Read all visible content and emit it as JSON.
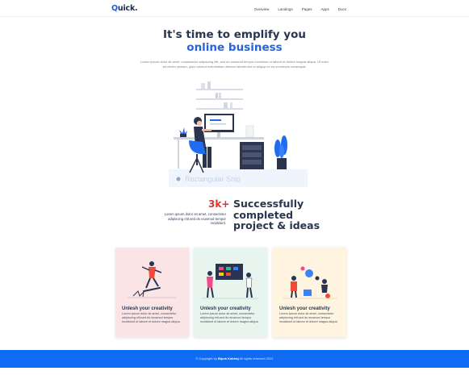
{
  "nav": {
    "logo_q": "Q",
    "logo_rest": "uick.",
    "links": [
      "Overview",
      "Landings",
      "Pages",
      "Apps",
      "Docs"
    ]
  },
  "hero": {
    "title_line1": "It's time to emplify you",
    "title_line2": "online business",
    "paragraph": "Lorem ipsum dolor sit amet, consectetur adipiscing elit, sed do eiusmod tempor incididunt ut labore et dolore magna aliqua. Ut enim ad minim veniam, quis nostrud exercitation ullamco laboris nisi ut aliquip ex ea commodo consequat.",
    "watermark": "Rectangular Snip"
  },
  "stats": {
    "number": "3k+",
    "small_text": "Lorem ipsum dolor sit amet, consectetur adipiscing elit,sed do eiusmod tempor incididunt.",
    "big_line1": "Successfully",
    "big_line2": "completed",
    "big_line3": "project & ideas"
  },
  "cards": [
    {
      "title": "Unlesh your creativity",
      "text": "Lorem ipsum dolor sit amet, consectetur adipiscing elit,sed do eiusmod tempor incididunt ut labore et dolore magna aliqua."
    },
    {
      "title": "Unlesh your creativity",
      "text": "Lorem ipsum dolor sit amet, consectetur adipiscing elit,sed do eiusmod tempor incididunt ut labore et dolore magna aliqua."
    },
    {
      "title": "Unlesh your creativity",
      "text": "Lorem ipsum dolor sit amet, consectetur adipiscing elit,sed do eiusmod tempor incididunt ut labore et dolore magna aliqua."
    }
  ],
  "footer": {
    "prefix": "© Copyright by",
    "author": "Bipok Kabiraj",
    "suffix": "All rights reserved 2021"
  },
  "colors": {
    "accent_blue": "#2a63d8",
    "stat_red": "#e0322c",
    "footer_blue": "#0f6bf2",
    "card1": "#fbe4e6",
    "card2": "#e7f5ee",
    "card3": "#fff4df"
  }
}
